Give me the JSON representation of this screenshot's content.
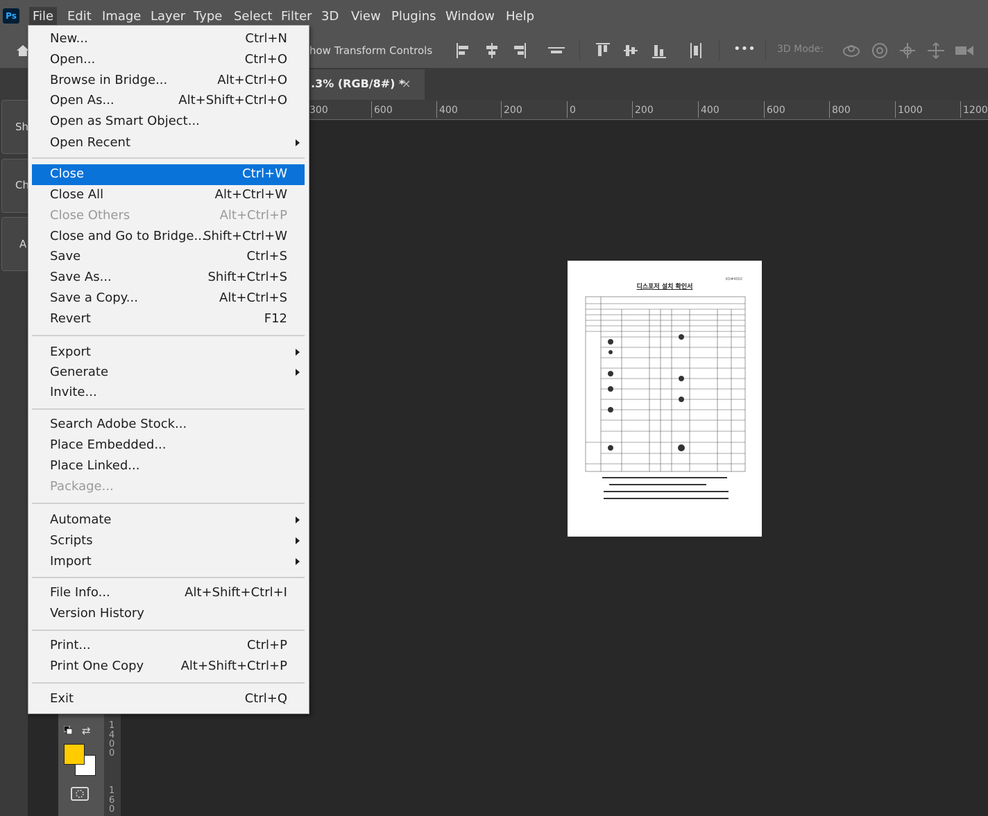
{
  "app": {
    "logo": "Ps"
  },
  "menubar": {
    "items": [
      "File",
      "Edit",
      "Image",
      "Layer",
      "Type",
      "Select",
      "Filter",
      "3D",
      "View",
      "Plugins",
      "Window",
      "Help"
    ],
    "active": "File"
  },
  "options": {
    "transform_label": "how Transform Controls",
    "mode_label": "3D Mode:",
    "more_label": "•••"
  },
  "tab": {
    "title": ".3% (RGB/8#) *",
    "close": "×"
  },
  "ruler": {
    "labels": [
      "300",
      "600",
      "400",
      "200",
      "0",
      "200",
      "400",
      "600",
      "800",
      "1000",
      "1200"
    ]
  },
  "left_panels": {
    "tabs": [
      "Sh",
      "Ch",
      "A"
    ]
  },
  "vertical_ruler": {
    "labels": [
      "1",
      "4",
      "0",
      "0",
      "1",
      "6",
      "0"
    ]
  },
  "colors": {
    "foreground": "#ffcc00",
    "background": "#ffffff",
    "highlight": "#0a73d9"
  },
  "document": {
    "title": "디스포저 설치 확인서",
    "corner": "KD#4002"
  },
  "file_menu": {
    "items": [
      {
        "label": "New...",
        "shortcut": "Ctrl+N"
      },
      {
        "label": "Open...",
        "shortcut": "Ctrl+O"
      },
      {
        "label": "Browse in Bridge...",
        "shortcut": "Alt+Ctrl+O"
      },
      {
        "label": "Open As...",
        "shortcut": "Alt+Shift+Ctrl+O"
      },
      {
        "label": "Open as Smart Object...",
        "shortcut": ""
      },
      {
        "label": "Open Recent",
        "shortcut": "",
        "submenu": true
      },
      {
        "label": "Close",
        "shortcut": "Ctrl+W",
        "highlighted": true
      },
      {
        "label": "Close All",
        "shortcut": "Alt+Ctrl+W"
      },
      {
        "label": "Close Others",
        "shortcut": "Alt+Ctrl+P",
        "disabled": true
      },
      {
        "label": "Close and Go to Bridge...",
        "shortcut": "Shift+Ctrl+W"
      },
      {
        "label": "Save",
        "shortcut": "Ctrl+S"
      },
      {
        "label": "Save As...",
        "shortcut": "Shift+Ctrl+S"
      },
      {
        "label": "Save a Copy...",
        "shortcut": "Alt+Ctrl+S"
      },
      {
        "label": "Revert",
        "shortcut": "F12"
      },
      {
        "label": "Export",
        "shortcut": "",
        "submenu": true
      },
      {
        "label": "Generate",
        "shortcut": "",
        "submenu": true
      },
      {
        "label": "Invite...",
        "shortcut": ""
      },
      {
        "label": "Search Adobe Stock...",
        "shortcut": ""
      },
      {
        "label": "Place Embedded...",
        "shortcut": ""
      },
      {
        "label": "Place Linked...",
        "shortcut": ""
      },
      {
        "label": "Package...",
        "shortcut": "",
        "disabled": true
      },
      {
        "label": "Automate",
        "shortcut": "",
        "submenu": true
      },
      {
        "label": "Scripts",
        "shortcut": "",
        "submenu": true
      },
      {
        "label": "Import",
        "shortcut": "",
        "submenu": true
      },
      {
        "label": "File Info...",
        "shortcut": "Alt+Shift+Ctrl+I"
      },
      {
        "label": "Version History",
        "shortcut": ""
      },
      {
        "label": "Print...",
        "shortcut": "Ctrl+P"
      },
      {
        "label": "Print One Copy",
        "shortcut": "Alt+Shift+Ctrl+P"
      },
      {
        "label": "Exit",
        "shortcut": "Ctrl+Q"
      }
    ]
  }
}
